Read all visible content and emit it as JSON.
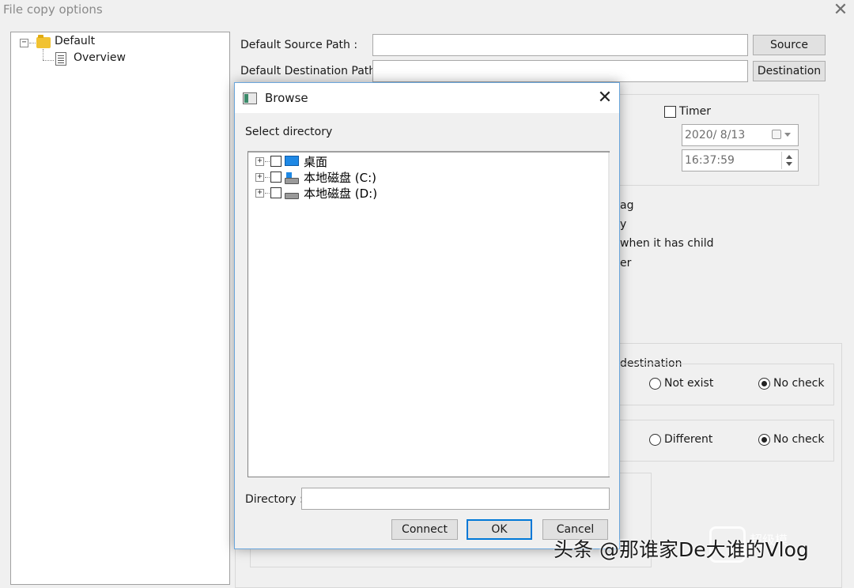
{
  "window": {
    "title": "File copy options",
    "close_glyph": "✕"
  },
  "tree": {
    "root": {
      "label": "Default",
      "expander": "−"
    },
    "child": {
      "label": "Overview"
    }
  },
  "form": {
    "source_label": "Default Source Path :",
    "source_value": "",
    "source_button": "Source",
    "dest_label": "Default Destination Path :",
    "dest_value": "",
    "dest_button": "Destination",
    "timer_label": "Timer",
    "timer_checked": false,
    "date_value": "2020/  8/13",
    "time_value": "16:37:59",
    "partial_options": [
      "ag",
      "y",
      "when it has child",
      "er"
    ],
    "destination_group_label": "destination",
    "row1": {
      "opt1": "Not exist",
      "opt2": "No check",
      "selected": "No check"
    },
    "row2": {
      "opt1": "Different",
      "opt2": "No check",
      "selected": "No check"
    }
  },
  "dialog": {
    "title": "Browse",
    "close_glyph": "✕",
    "select_label": "Select directory",
    "items": [
      {
        "label": "桌面",
        "icon": "desktop-icon",
        "expander": "+"
      },
      {
        "label": "本地磁盘 (C:)",
        "icon": "drive-c-icon",
        "expander": "+"
      },
      {
        "label": "本地磁盘 (D:)",
        "icon": "drive-d-icon",
        "expander": "+"
      }
    ],
    "directory_label": "Directory :",
    "directory_value": "",
    "connect_button": "Connect",
    "ok_button": "OK",
    "cancel_button": "Cancel"
  },
  "watermark": {
    "text": "头条 @那谁家De大谁的Vlog",
    "sub": "超级模"
  },
  "colors": {
    "accent": "#0078d7",
    "window_bg": "#f0f0f0"
  }
}
